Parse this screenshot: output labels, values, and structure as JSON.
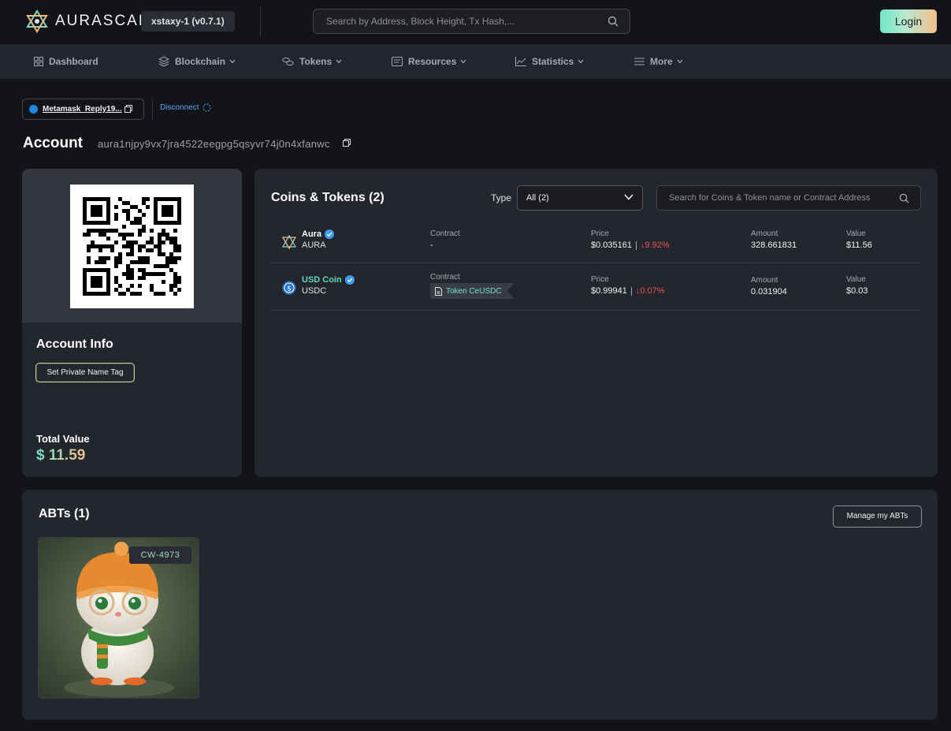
{
  "header": {
    "logo_text": "AURASCAN",
    "chain_badge": "xstaxy-1 (v0.7.1)",
    "search_placeholder": "Search by Address, Block Height, Tx Hash,...",
    "login_label": "Login"
  },
  "nav": {
    "items": [
      {
        "label": "Dashboard",
        "icon": "dashboard-icon"
      },
      {
        "label": "Blockchain",
        "icon": "layers-icon"
      },
      {
        "label": "Tokens",
        "icon": "coins-icon"
      },
      {
        "label": "Resources",
        "icon": "resources-icon"
      },
      {
        "label": "Statistics",
        "icon": "chart-icon"
      },
      {
        "label": "More",
        "icon": "menu-icon"
      }
    ]
  },
  "wallet": {
    "name": "Metamask_Reply19...",
    "disconnect_label": "Disconnect"
  },
  "account": {
    "title": "Account",
    "address": "aura1njpy9vx7jra4522eegpg5qsyvr74j0n4xfanwc"
  },
  "account_info": {
    "title": "Account Info",
    "tag_button": "Set Private Name Tag",
    "total_label": "Total Value",
    "total_value": "$ 11.59"
  },
  "coins": {
    "title": "Coins & Tokens (2)",
    "type_label": "Type",
    "type_value": "All (2)",
    "search_placeholder": "Search for Coins & Token name or Contract Address",
    "col_contract": "Contract",
    "col_price": "Price",
    "col_amount": "Amount",
    "col_value": "Value",
    "rows": [
      {
        "name": "Aura",
        "symbol": "AURA",
        "contract": "-",
        "price": "$0.035161",
        "change": "↓9.92%",
        "amount": "328.661831",
        "value": "$11.56"
      },
      {
        "name": "USD Coin",
        "symbol": "USDC",
        "contract": "Token CeUSDC",
        "price": "$0.99941",
        "change": "↓0.07%",
        "amount": "0.031904",
        "value": "$0.03"
      }
    ]
  },
  "abts": {
    "title": "ABTs (1)",
    "manage_button": "Manage my ABTs",
    "items": [
      {
        "badge": "CW-4973"
      }
    ]
  },
  "colors": {
    "background": "#131419",
    "card": "#24262d",
    "accent_teal": "#6ee7c7",
    "accent_orange": "#f4bf8c",
    "negative": "#e5535a"
  }
}
